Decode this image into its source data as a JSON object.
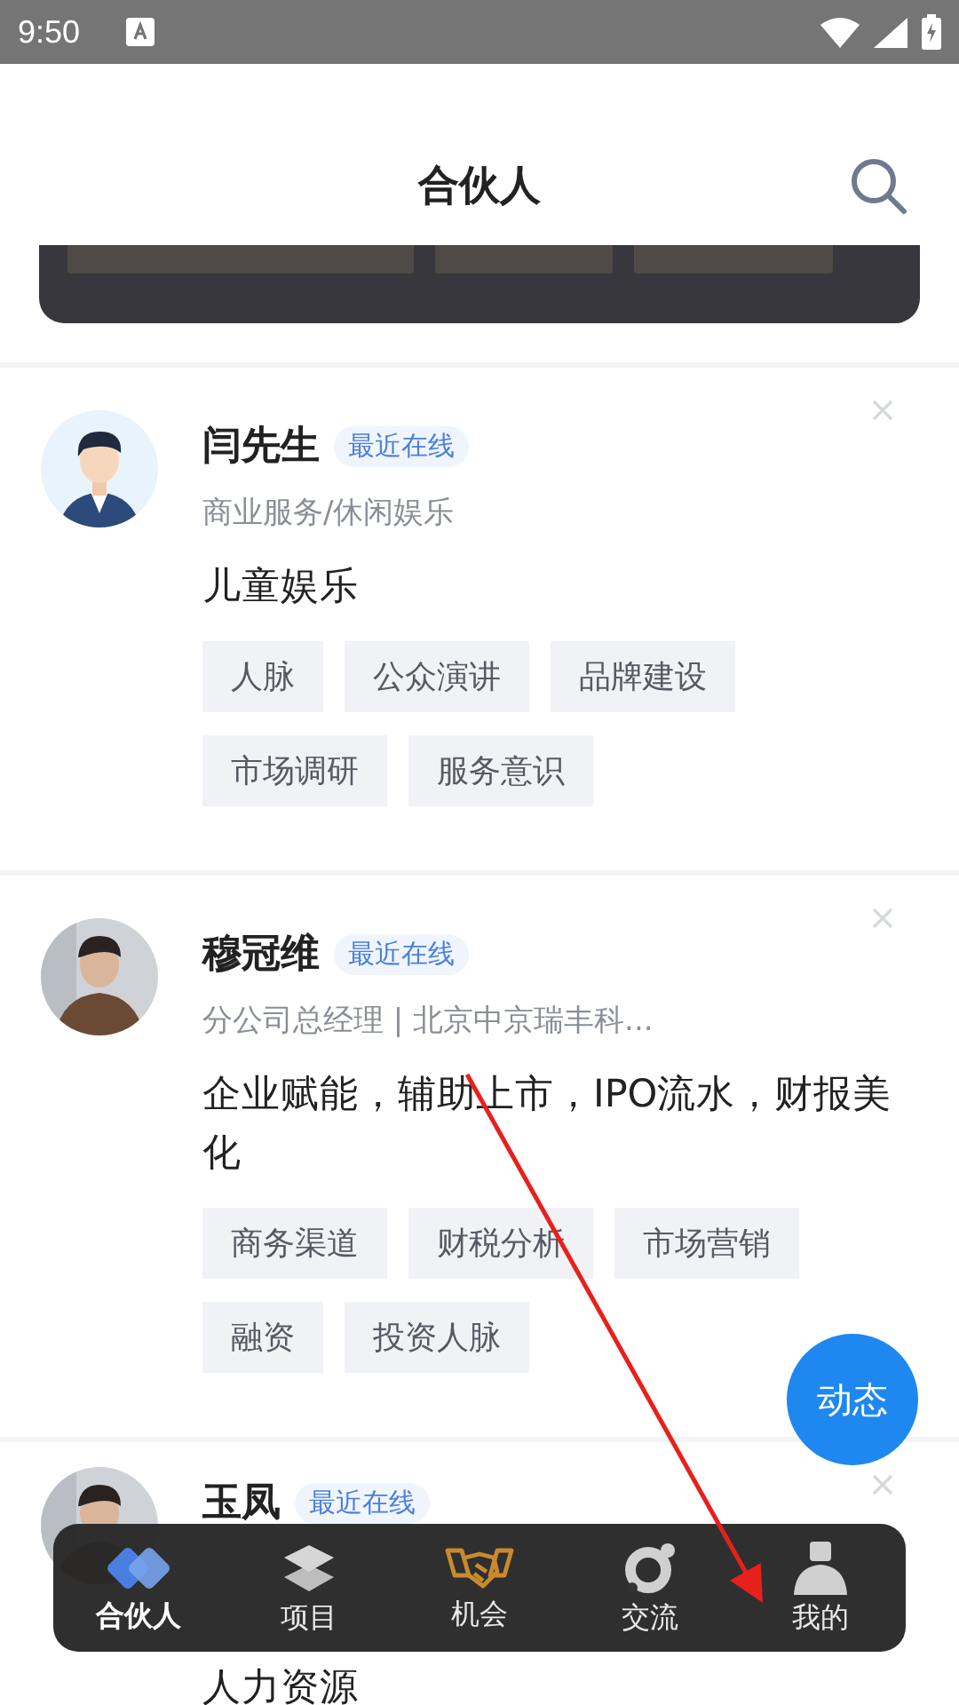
{
  "status_bar": {
    "time": "9:50"
  },
  "header": {
    "title": "合伙人"
  },
  "partners": [
    {
      "name": "闫先生",
      "badge": "最近在线",
      "subtitle": "商业服务/休闲娱乐",
      "intro": "儿童娱乐",
      "tags": [
        "人脉",
        "公众演讲",
        "品牌建设",
        "市场调研",
        "服务意识"
      ],
      "avatar": {
        "kind": "illustration"
      }
    },
    {
      "name": "穆冠维",
      "badge": "最近在线",
      "subtitle": "分公司总经理 | 北京中京瑞丰科...",
      "intro": "企业赋能，辅助上市，IPO流水，财报美化",
      "tags": [
        "商务渠道",
        "财税分析",
        "市场营销",
        "融资",
        "投资人脉"
      ]
    },
    {
      "name": "玉凤",
      "badge": "最近在线",
      "intro": "人力资源"
    }
  ],
  "float_button": {
    "label": "动态"
  },
  "nav": [
    {
      "label": "合伙人",
      "selected": true
    },
    {
      "label": "项目",
      "selected": false
    },
    {
      "label": "机会",
      "selected": false
    },
    {
      "label": "交流",
      "selected": false
    },
    {
      "label": "我的",
      "selected": false
    }
  ]
}
